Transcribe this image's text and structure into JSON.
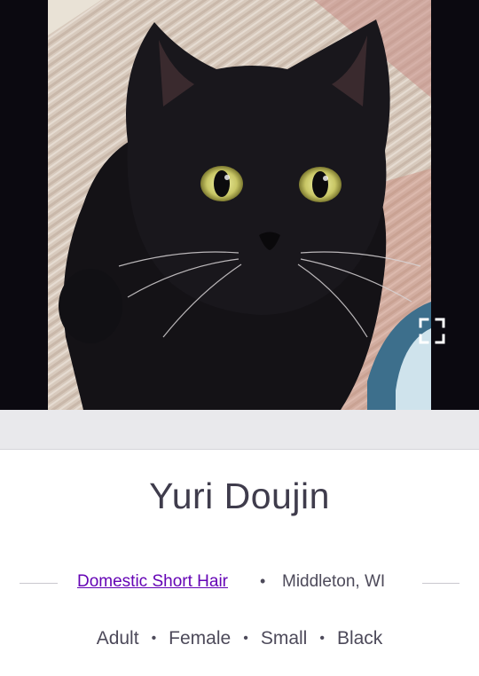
{
  "photo": {
    "subject_icon": "black-cat-photo",
    "fullscreen_icon": "fullscreen-expand-icon"
  },
  "pet": {
    "name": "Yuri Doujin",
    "breed": "Domestic Short Hair",
    "location": "Middleton, WI",
    "age": "Adult",
    "sex": "Female",
    "size": "Small",
    "color": "Black"
  },
  "separator": "•",
  "colors": {
    "link": "#6504b5",
    "text": "#4d4a5a",
    "name": "#3f3c4c"
  }
}
